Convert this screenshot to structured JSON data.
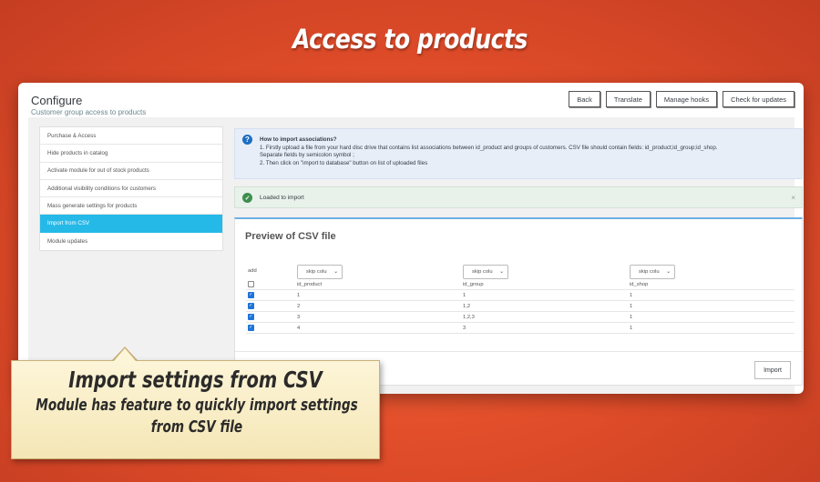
{
  "hero_title": "Access to products",
  "header": {
    "title": "Configure",
    "subtitle": "Customer group access to products"
  },
  "toolbar": {
    "back": "Back",
    "translate": "Translate",
    "manage_hooks": "Manage hooks",
    "check_updates": "Check for updates"
  },
  "sidebar": {
    "items": [
      {
        "label": "Purchase & Access",
        "active": false
      },
      {
        "label": "Hide products in catalog",
        "active": false
      },
      {
        "label": "Activate module for out of stock products",
        "active": false
      },
      {
        "label": "Additional visibility conditions for customers",
        "active": false
      },
      {
        "label": "Mass generate settings for products",
        "active": false
      },
      {
        "label": "Import from CSV",
        "active": true
      },
      {
        "label": "Module updates",
        "active": false
      }
    ]
  },
  "info": {
    "heading": "How to import associations?",
    "line1": "1. Firstly upload a file from your hard disc drive that contains list associations between id_product and groups of customers. CSV file should contain fields: id_product;id_group;id_shop.",
    "line2": "Separate fields by semicolon symbol ;",
    "line3": "2. Then click on \"import to database\" button on list of uploaded files"
  },
  "success": {
    "message": "Loaded to import",
    "close": "×"
  },
  "panel": {
    "title": "Preview of CSV file",
    "import_button": "Import",
    "add_label": "add",
    "column_select": "skip colu",
    "headers": [
      "id_product",
      "id_group",
      "id_shop"
    ],
    "rows": [
      {
        "checked": true,
        "cells": [
          "1",
          "1",
          "1"
        ]
      },
      {
        "checked": true,
        "cells": [
          "2",
          "1,2",
          "1"
        ]
      },
      {
        "checked": true,
        "cells": [
          "3",
          "1,2,3",
          "1"
        ]
      },
      {
        "checked": true,
        "cells": [
          "4",
          "3",
          "1"
        ]
      }
    ]
  },
  "tooltip": {
    "title": "Import settings from CSV",
    "text": "Module has feature to quickly import settings from CSV file"
  },
  "colors": {
    "accent": "#25b9e8",
    "background": "#e24e2a",
    "info_icon": "#1c6fc4",
    "success_icon": "#3d8e4d"
  }
}
